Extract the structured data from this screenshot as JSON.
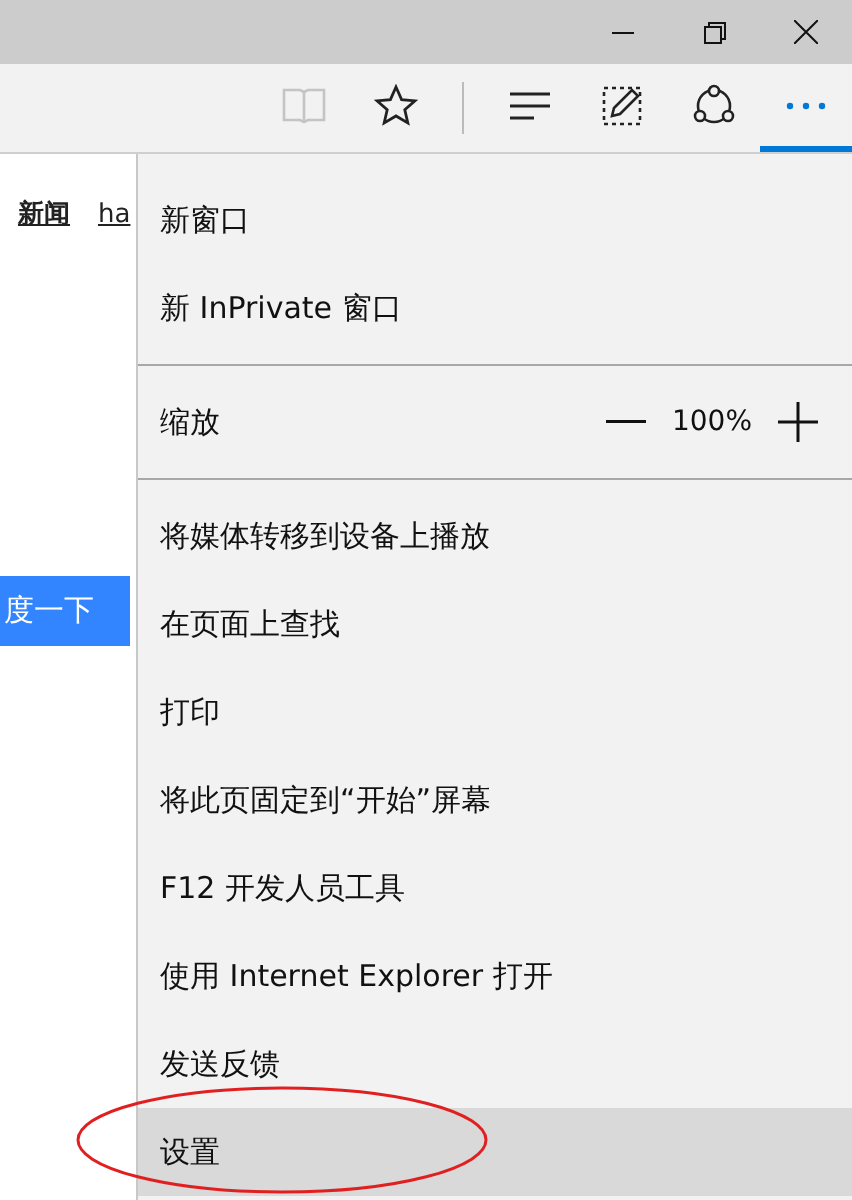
{
  "toolbar": [
    {
      "kind": "reading",
      "disabled": true,
      "selected": false
    },
    {
      "kind": "favorite",
      "disabled": false,
      "selected": false
    },
    {
      "kind": "hub",
      "disabled": false,
      "selected": false
    },
    {
      "kind": "note",
      "disabled": false,
      "selected": false
    },
    {
      "kind": "share",
      "disabled": false,
      "selected": false
    },
    {
      "kind": "more",
      "disabled": false,
      "selected": true
    }
  ],
  "page": {
    "links": [
      "新闻",
      "ha"
    ],
    "search_button": "度一下"
  },
  "menu": {
    "sections": [
      [
        {
          "kind": "item",
          "label": "新窗口",
          "selected": false
        },
        {
          "kind": "item",
          "label": "新 InPrivate 窗口",
          "selected": false
        }
      ],
      [
        {
          "kind": "zoom",
          "label": "缩放",
          "value": "100%",
          "selected": false
        }
      ],
      [
        {
          "kind": "item",
          "label": "将媒体转移到设备上播放",
          "selected": false
        },
        {
          "kind": "item",
          "label": "在页面上查找",
          "selected": false
        },
        {
          "kind": "item",
          "label": "打印",
          "selected": false
        },
        {
          "kind": "item",
          "label": "将此页固定到“开始”屏幕",
          "selected": false
        },
        {
          "kind": "item",
          "label": "F12 开发人员工具",
          "selected": false
        },
        {
          "kind": "item",
          "label": "使用 Internet Explorer 打开",
          "selected": false
        },
        {
          "kind": "item",
          "label": "发送反馈",
          "selected": false
        },
        {
          "kind": "item",
          "label": "设置",
          "selected": true
        }
      ]
    ]
  },
  "annotation": {
    "kind": "ellipse",
    "color": "#e02020"
  }
}
